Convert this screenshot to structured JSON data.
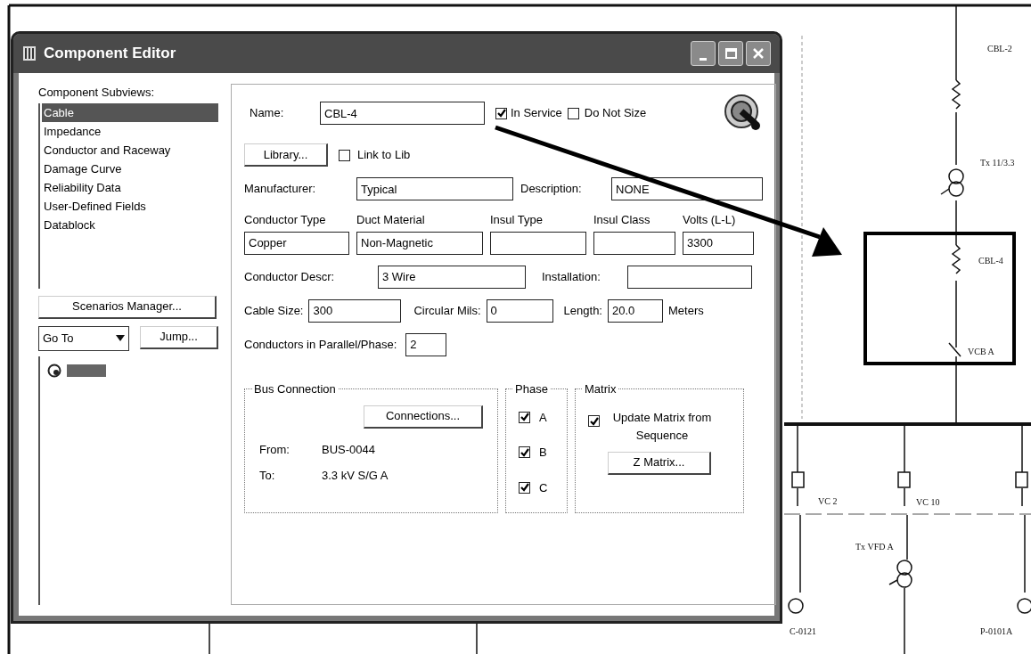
{
  "window": {
    "title": "Component Editor"
  },
  "subviews": {
    "label": "Component Subviews:",
    "items": [
      {
        "label": "Cable",
        "selected": true
      },
      {
        "label": "Impedance",
        "selected": false
      },
      {
        "label": "Conductor and Raceway",
        "selected": false
      },
      {
        "label": "Damage Curve",
        "selected": false
      },
      {
        "label": "Reliability Data",
        "selected": false
      },
      {
        "label": "User-Defined Fields",
        "selected": false
      },
      {
        "label": "Datablock",
        "selected": false
      }
    ]
  },
  "scenarios_button": "Scenarios Manager...",
  "goto": {
    "value": "Go To"
  },
  "jump_button": "Jump...",
  "form": {
    "name": {
      "label": "Name:",
      "value": "CBL-4"
    },
    "in_service": {
      "label": "In Service",
      "checked": true
    },
    "do_not_size": {
      "label": "Do Not Size",
      "checked": false
    },
    "library_button": "Library...",
    "link_to_lib": {
      "label": "Link to Lib",
      "checked": false
    },
    "manufacturer": {
      "label": "Manufacturer:",
      "value": "Typical"
    },
    "description": {
      "label": "Description:",
      "value": "NONE"
    },
    "columns": [
      {
        "label": "Conductor Type",
        "value": "Copper"
      },
      {
        "label": "Duct Material",
        "value": "Non-Magnetic"
      },
      {
        "label": "Insul Type"
      },
      {
        "label": "Insul Class"
      },
      {
        "label": "Volts (L-L)",
        "value": "3300"
      }
    ],
    "conductor_descr": {
      "label": "Conductor Descr:",
      "value": "3 Wire"
    },
    "installation": {
      "label": "Installation:"
    },
    "cable_size": {
      "label": "Cable Size:",
      "value": "300"
    },
    "circular_mils": {
      "label": "Circular Mils:",
      "value": "0"
    },
    "length": {
      "label": "Length:",
      "value": "20.0",
      "unit": "Meters"
    },
    "parallel": {
      "label": "Conductors in Parallel/Phase:",
      "value": "2"
    }
  },
  "bus_connection": {
    "title": "Bus Connection",
    "button": "Connections...",
    "from_label": "From:",
    "from": "BUS-0044",
    "to_label": "To:",
    "to": "3.3 kV S/G A"
  },
  "phase": {
    "title": "Phase",
    "items": [
      {
        "label": "A",
        "checked": true
      },
      {
        "label": "B",
        "checked": true
      },
      {
        "label": "C",
        "checked": true
      }
    ]
  },
  "matrix": {
    "title": "Matrix",
    "update": {
      "label": "Update Matrix from Sequence",
      "checked": true
    },
    "button": "Z Matrix..."
  },
  "diagram": {
    "labels": [
      {
        "text": "CBL-2"
      },
      {
        "text": "Tx 11/3.3"
      },
      {
        "text": "CBL-4"
      },
      {
        "text": "VCB A"
      },
      {
        "text": "VC 2"
      },
      {
        "text": "VC 10"
      },
      {
        "text": "Tx VFD A"
      },
      {
        "text": "C-0121"
      },
      {
        "text": "P-0101A"
      }
    ]
  }
}
